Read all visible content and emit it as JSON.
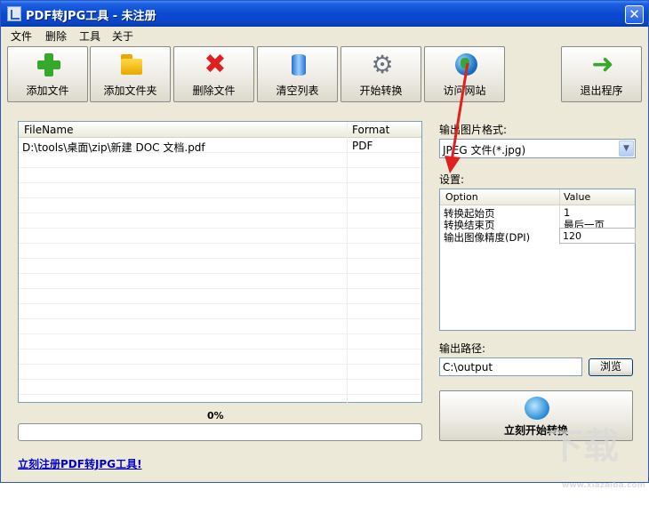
{
  "window": {
    "title": "PDF转JPG工具 - 未注册",
    "close_glyph": "✕"
  },
  "menu": {
    "items": [
      "文件",
      "删除",
      "工具",
      "关于"
    ]
  },
  "toolbar": {
    "buttons": [
      {
        "label": "添加文件",
        "icon": "add-plus-icon"
      },
      {
        "label": "添加文件夹",
        "icon": "folder-icon"
      },
      {
        "label": "删除文件",
        "icon": "delete-x-icon"
      },
      {
        "label": "清空列表",
        "icon": "clear-list-icon"
      },
      {
        "label": "开始转换",
        "icon": "gear-icon"
      },
      {
        "label": "访问网站",
        "icon": "globe-icon"
      },
      {
        "label": "退出程序",
        "icon": "exit-arrow-icon"
      }
    ]
  },
  "file_list": {
    "columns": [
      "FileName",
      "Format"
    ],
    "rows": [
      {
        "filename": "D:\\tools\\桌面\\zip\\新建 DOC 文档.pdf",
        "format": "PDF"
      }
    ]
  },
  "progress": {
    "percent_label": "0%",
    "value": 0.0
  },
  "register_link": "立刻注册PDF转JPG工具!",
  "output_format": {
    "label": "输出图片格式:",
    "selected": "JPEG 文件(*.jpg)"
  },
  "settings": {
    "label": "设置:",
    "columns": [
      "Option",
      "Value"
    ],
    "rows": [
      {
        "option": "转换起始页",
        "value": "1"
      },
      {
        "option": "转换结束页",
        "value": "最后一页"
      },
      {
        "option": "输出图像精度(DPI)",
        "value": "120"
      }
    ]
  },
  "output_path": {
    "label": "输出路径:",
    "value": "C:\\output",
    "browse_label": "浏览"
  },
  "convert_button": {
    "label": "立刻开始转换"
  },
  "colors": {
    "titlebar": "#0a4ad2",
    "accent_arrow": "#e02020",
    "link": "#0000cc"
  }
}
